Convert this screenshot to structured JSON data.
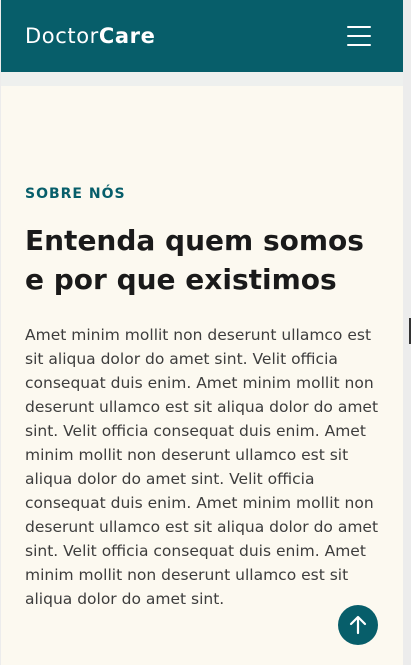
{
  "header": {
    "logo_light": "Doctor",
    "logo_bold": "Care",
    "menu_icon": "hamburger-menu-icon"
  },
  "about": {
    "eyebrow": "SOBRE NÓS",
    "heading": "Entenda quem somos e por que existimos",
    "body": "Amet minim mollit non deserunt ullamco est sit aliqua dolor do amet sint. Velit officia consequat duis enim. Amet minim mollit non deserunt ullamco est sit aliqua dolor do amet sint. Velit officia consequat duis enim. Amet minim mollit non deserunt ullamco est sit aliqua dolor do amet sint. Velit officia consequat duis enim. Amet minim mollit non deserunt ullamco est sit aliqua dolor do amet sint. Velit officia consequat duis enim. Amet minim mollit non deserunt ullamco est sit aliqua dolor do amet sint."
  },
  "scroll_top": {
    "icon": "arrow-up-icon"
  },
  "colors": {
    "brand": "#075e6a",
    "background": "#fcf9f0",
    "heading": "#1a1a1a",
    "body": "#3d3d3d"
  }
}
